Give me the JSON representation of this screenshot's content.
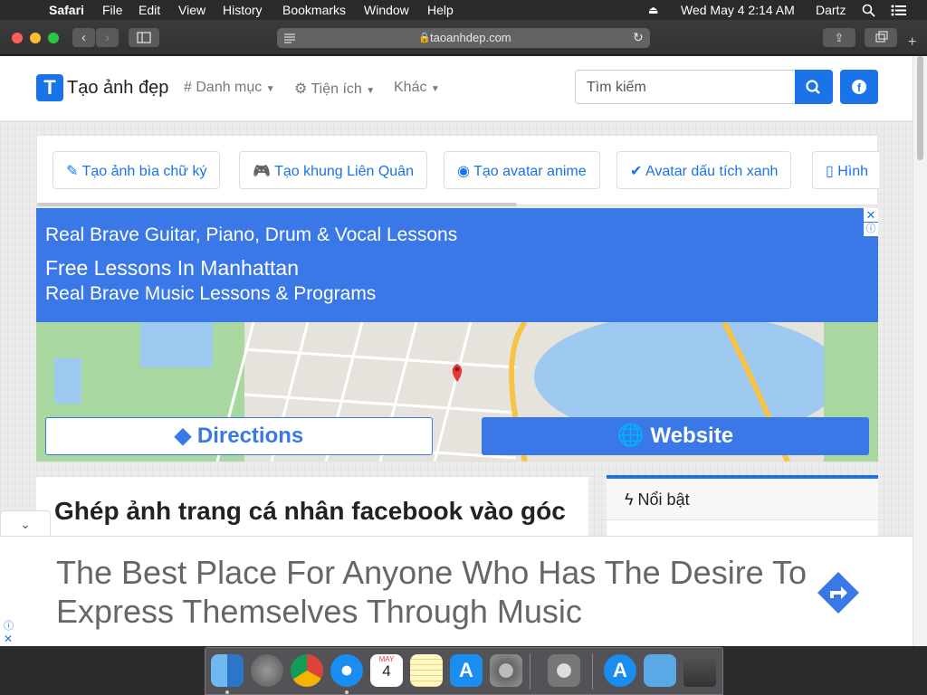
{
  "menubar": {
    "apple": "",
    "app": "Safari",
    "items": [
      "File",
      "Edit",
      "View",
      "History",
      "Bookmarks",
      "Window",
      "Help"
    ],
    "datetime": "Wed May 4  2:14 AM",
    "user": "Dartz"
  },
  "browser": {
    "url": "taoanhdep.com"
  },
  "site": {
    "logo_letter": "T",
    "logo_text": "Tạo ảnh đẹp",
    "nav": [
      {
        "icon": "#",
        "label": "Danh mục"
      },
      {
        "icon": "⚙",
        "label": "Tiện ích"
      },
      {
        "icon": "",
        "label": "Khác"
      }
    ],
    "search_placeholder": "Tìm kiếm"
  },
  "quick_links": [
    "Tạo ảnh bìa chữ ký",
    "Tạo khung Liên Quân",
    "Tạo avatar anime",
    "Avatar dấu tích xanh",
    "Hình"
  ],
  "ad1": {
    "line1": "Real Brave Guitar, Piano, Drum & Vocal Lessons",
    "line2": "Free Lessons In Manhattan",
    "line3": "Real Brave Music Lessons & Programs",
    "directions": "Directions",
    "website": "Website"
  },
  "article": {
    "title": "Ghép ảnh trang cá nhân facebook vào góc"
  },
  "sidebar": {
    "title": "Nổi bật"
  },
  "ad2": {
    "text": "The Best Place For Anyone Who Has The Desire To Express Themselves Through Music"
  },
  "dock": {
    "calendar_month": "MAY",
    "calendar_day": "4"
  },
  "colors": {
    "accent": "#1a73e8",
    "ad_blue": "#3b78e7"
  }
}
